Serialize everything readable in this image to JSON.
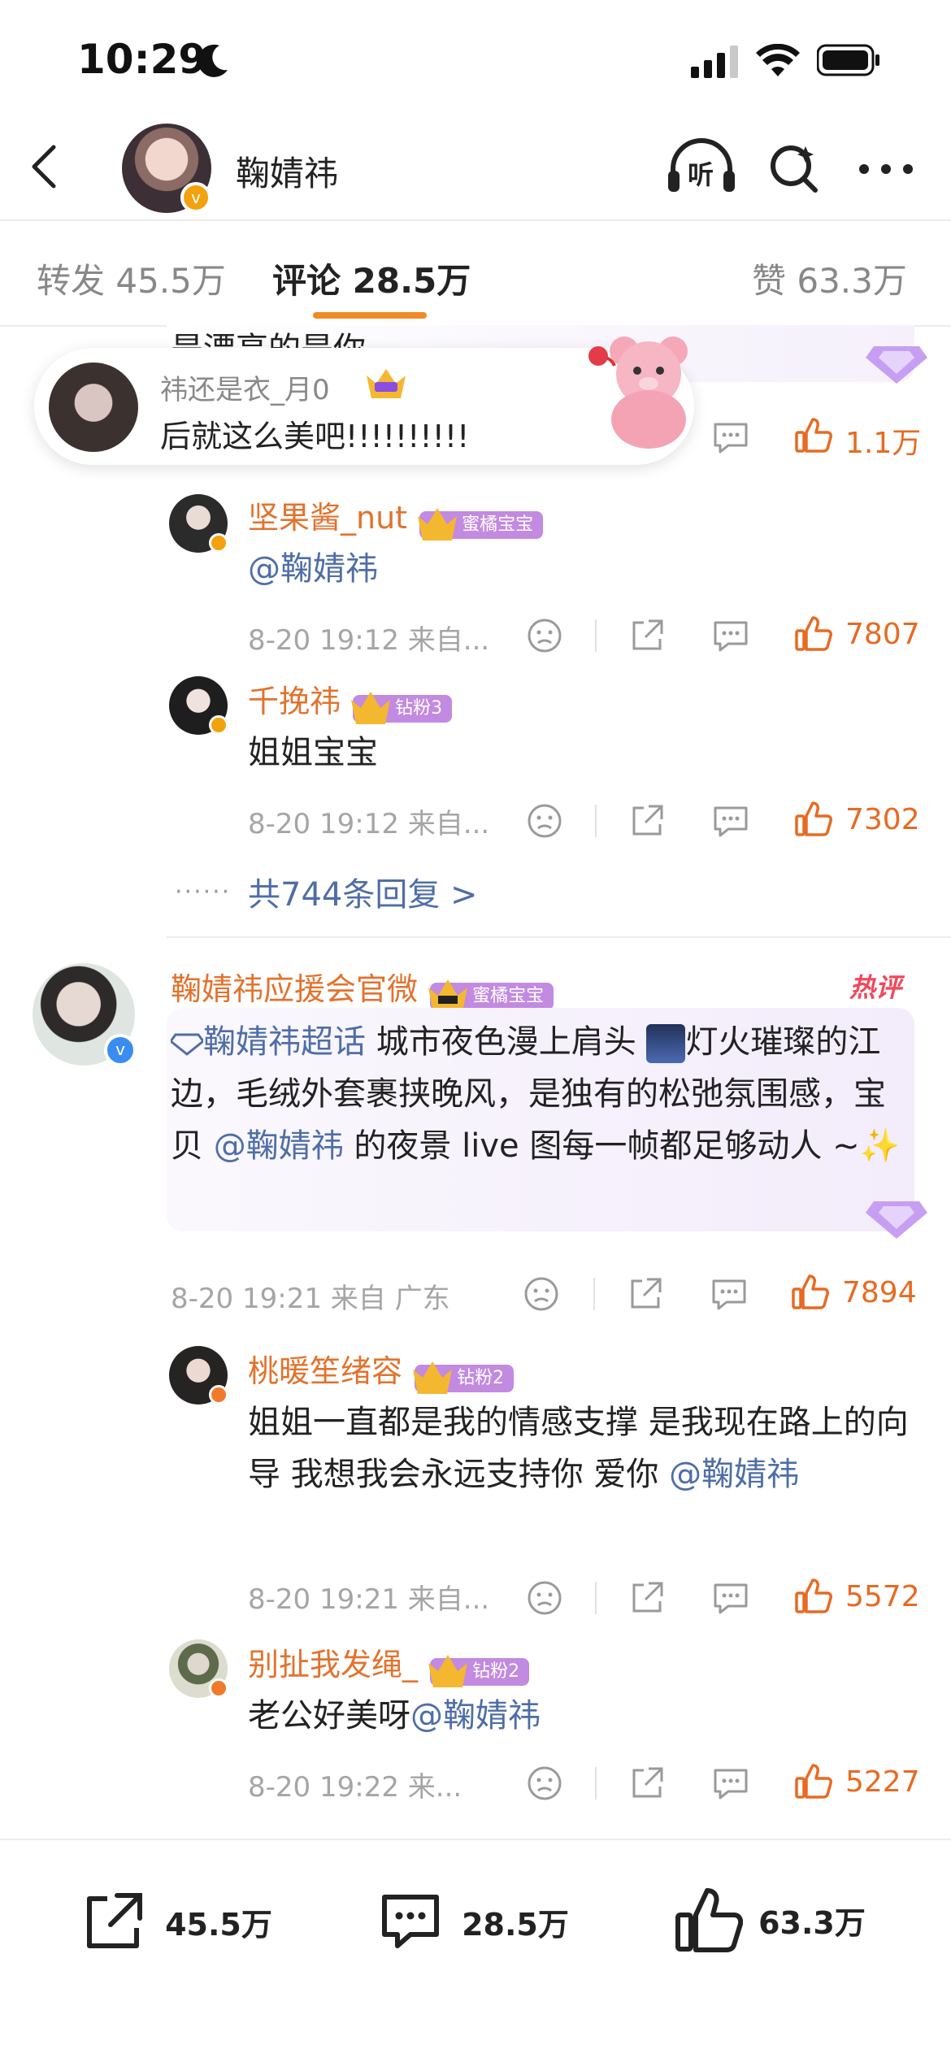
{
  "status_bar": {
    "time": "10:29"
  },
  "header": {
    "username": "鞠婧祎",
    "listen_label": "听"
  },
  "tabs": {
    "repost": "转发 45.5万",
    "comment": "评论 28.5万",
    "like": "赞 63.3万"
  },
  "pinned": {
    "partial_text": "是漂亮的是你",
    "user": "祎还是衣_月0",
    "text": "后就这么美吧!!!!!!!!!!",
    "likes": "1.1万"
  },
  "replies_a": [
    {
      "name": "坚果酱_nut",
      "badge": "蜜橘宝宝",
      "text": "@鞠婧祎",
      "time": "8-20 19:12 来自...",
      "likes": "7807"
    },
    {
      "name": "千挽祎",
      "badge": "钻粉3",
      "text": "姐姐宝宝",
      "time": "8-20 19:12 来自...",
      "likes": "7302"
    }
  ],
  "more_replies": "共744条回复 >",
  "main_comment": {
    "name": "鞠婧祎应援会官微",
    "badge": "蜜橘宝宝",
    "hot_tag": "热评",
    "topic": "鞠婧祎超话",
    "text1": " 城市夜色漫上肩头 ",
    "text2": "灯火璀璨的江边，毛绒外套裹挟晚风，是独有的松弛氛围感，宝贝 ",
    "mention": "@鞠婧祎",
    "text3": " 的夜景 live 图每一帧都足够动人 ~✨",
    "time": "8-20 19:21 来自 广东",
    "likes": "7894"
  },
  "replies_b": [
    {
      "name": "桃暖笙绪容",
      "badge": "钻粉2",
      "text_before": "姐姐一直都是我的情感支撑 是我现在路上的向导 我想我会永远支持你 爱你 ",
      "mention": "@鞠婧祎",
      "time": "8-20 19:21 来自...",
      "likes": "5572"
    },
    {
      "name": "别扯我发绳_",
      "badge": "钻粉2",
      "text_before": "老公好美呀",
      "mention": "@鞠婧祎",
      "time": "8-20 19:22 来...",
      "likes": "5227"
    }
  ],
  "bottom_bar": {
    "repost": "45.5万",
    "comment": "28.5万",
    "like": "63.3万"
  }
}
